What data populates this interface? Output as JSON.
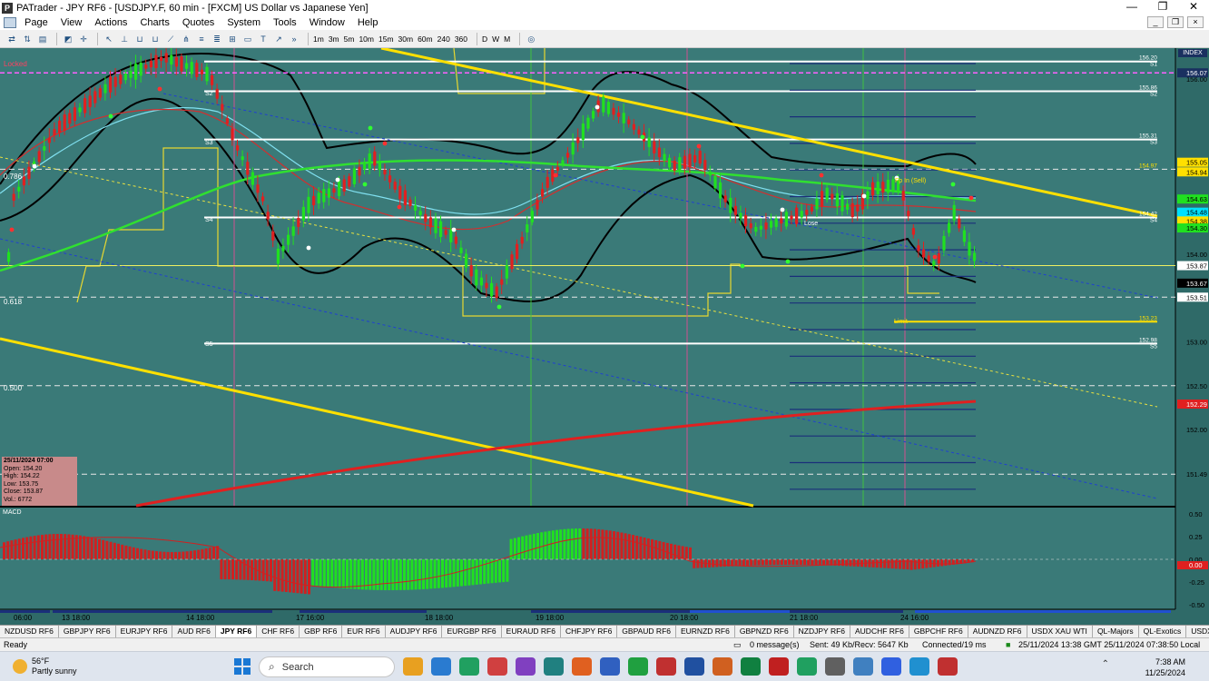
{
  "window": {
    "title": "PATrader - JPY RF6 - [USDJPY.F, 60 min - [FXCM] US Dollar vs Japanese Yen]",
    "controls": [
      "—",
      "❐",
      "✕"
    ]
  },
  "menu": {
    "items": [
      "Page",
      "View",
      "Actions",
      "Charts",
      "Quotes",
      "System",
      "Tools",
      "Window",
      "Help"
    ]
  },
  "toolbar": {
    "timeframes": [
      "1m",
      "3m",
      "5m",
      "10m",
      "15m",
      "30m",
      "60m",
      "240",
      "360"
    ],
    "periods": [
      "D",
      "W",
      "M"
    ]
  },
  "chart": {
    "locked_label": "Locked",
    "index_label": "INDEX",
    "price_axis": [
      {
        "text": "156.00",
        "y": 156.0
      },
      {
        "text": "155.05",
        "y": 155.05
      },
      {
        "text": "154.94",
        "y": 154.94
      },
      {
        "text": "154.63",
        "y": 154.63
      },
      {
        "text": "154.48",
        "y": 154.48
      },
      {
        "text": "154.38",
        "y": 154.38
      },
      {
        "text": "154.30",
        "y": 154.3
      },
      {
        "text": "154.00",
        "y": 154.0
      },
      {
        "text": "153.87",
        "y": 153.87
      },
      {
        "text": "153.67",
        "y": 153.67
      },
      {
        "text": "153.51",
        "y": 153.51
      },
      {
        "text": "153.00",
        "y": 153.0
      },
      {
        "text": "152.50",
        "y": 152.5
      },
      {
        "text": "152.29",
        "y": 152.29
      },
      {
        "text": "152.00",
        "y": 152.0
      },
      {
        "text": "151.49",
        "y": 151.49
      },
      {
        "text": "156.07",
        "y": 156.07
      }
    ],
    "pivot_labels": [
      {
        "price": "156.20",
        "tag": "S1"
      },
      {
        "price": "155.86",
        "tag": "S2"
      },
      {
        "price": "155.31",
        "tag": "S3"
      },
      {
        "price": "154.97",
        "tag": ""
      },
      {
        "price": "154.42",
        "tag": "S4"
      },
      {
        "price": "153.23",
        "tag": ""
      },
      {
        "price": "152.98",
        "tag": "S5"
      }
    ],
    "left_tags": [
      "S2",
      "S3",
      "S4",
      "S5"
    ],
    "fib_labels": [
      "0.786",
      "0.618",
      "0.500"
    ],
    "annotations": [
      "Fp In (Sell)",
      "Lose",
      "Limit"
    ],
    "time_axis": [
      "06:00",
      "13 18:00",
      "14 18:00",
      "17 16:00",
      "18 18:00",
      "19 18:00",
      "20 18:00",
      "21 18:00",
      "24 16:00"
    ],
    "ohlc_box": {
      "date": "25/11/2024 07:00",
      "open": "Open: 154.20",
      "high": "High: 154.22",
      "low": "Low: 153.75",
      "close": "Close: 153.87",
      "vol": "Vol.: 6772"
    },
    "macd": {
      "label": "MACD",
      "axis": [
        "0.50",
        "0.25",
        "0.00",
        "-0.25",
        "-0.50",
        "0.00"
      ]
    }
  },
  "tabs": [
    "NZDUSD RF6",
    "GBPJPY RF6",
    "EURJPY RF6",
    "AUD RF6",
    "JPY RF6",
    "CHF RF6",
    "GBP RF6",
    "EUR RF6",
    "AUDJPY RF6",
    "EURGBP RF6",
    "EURAUD RF6",
    "CHFJPY RF6",
    "GBPAUD RF6",
    "EURNZD RF6",
    "GBPNZD RF6",
    "NZDJPY RF6",
    "AUDCHF RF6",
    "GBPCHF RF6",
    "AUDNZD RF6",
    "USDX XAU WTI",
    "QL-Majors",
    "QL-Exotics",
    "USDX RF6",
    "Bitcoin",
    "SP500 RF6",
    "DJIA"
  ],
  "active_tab": "JPY RF6",
  "status": {
    "ready": "Ready",
    "messages": "0 message(s)",
    "traffic": "Sent: 49 Kb/Recv: 5647 Kb",
    "connection": "Connected/19 ms",
    "clock": "25/11/2024 13:38 GMT  25/11/2024 07:38:50 Local"
  },
  "taskbar": {
    "temp": "56°F",
    "weather": "Partly sunny",
    "search": "Search",
    "time": "7:38 AM",
    "date": "11/25/2024"
  }
}
